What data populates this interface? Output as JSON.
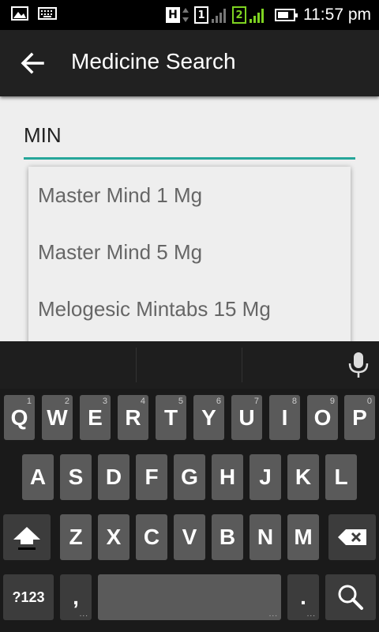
{
  "status_bar": {
    "network_type": "H",
    "sim1": "1",
    "sim2": "2",
    "time": "11:57 pm",
    "icons": [
      "image-icon",
      "keyboard-icon"
    ],
    "battery_level_pct": 80,
    "accent_green": "#7ed321"
  },
  "app_bar": {
    "title": "Medicine Search",
    "back_icon": "arrow-left-icon"
  },
  "search": {
    "value": "MIN",
    "underline_color": "#26a69a"
  },
  "suggestions": [
    "Master Mind 1 Mg",
    "Master Mind 5 Mg",
    "Melogesic Mintabs 15 Mg"
  ],
  "keyboard": {
    "row1": [
      {
        "label": "Q",
        "hint": "1"
      },
      {
        "label": "W",
        "hint": "2"
      },
      {
        "label": "E",
        "hint": "3"
      },
      {
        "label": "R",
        "hint": "4"
      },
      {
        "label": "T",
        "hint": "5"
      },
      {
        "label": "Y",
        "hint": "6"
      },
      {
        "label": "U",
        "hint": "7"
      },
      {
        "label": "I",
        "hint": "8"
      },
      {
        "label": "O",
        "hint": "9"
      },
      {
        "label": "P",
        "hint": "0"
      }
    ],
    "row2": [
      "A",
      "S",
      "D",
      "F",
      "G",
      "H",
      "J",
      "K",
      "L"
    ],
    "row3": [
      "Z",
      "X",
      "C",
      "V",
      "B",
      "N",
      "M"
    ],
    "symbols_label": "?123",
    "comma_label": ",",
    "period_label": ".",
    "more_dots": "..."
  }
}
